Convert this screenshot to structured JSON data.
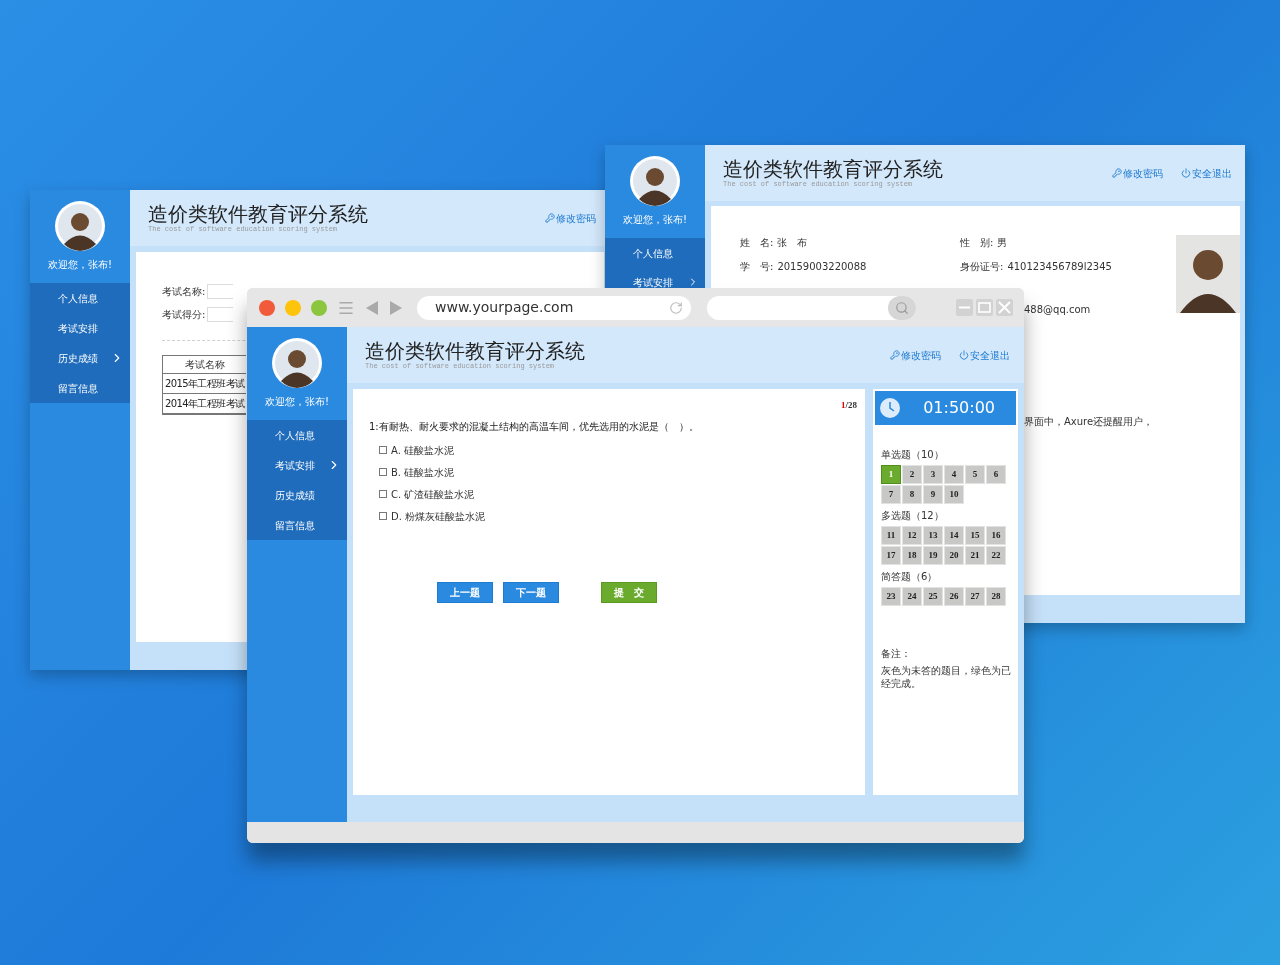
{
  "left_window": {
    "header": {
      "title": "造价类软件教育评分系统",
      "subtitle": "The cost of software education scoring system",
      "links": [
        {
          "kind": "key",
          "label": "修改密码"
        }
      ]
    },
    "sidebar": {
      "welcome": "欢迎您，张布!",
      "items": [
        {
          "label": "个人信息",
          "has_submenu": false
        },
        {
          "label": "考试安排",
          "has_submenu": false
        },
        {
          "label": "历史成绩",
          "has_submenu": true
        },
        {
          "label": "留言信息",
          "has_submenu": false
        }
      ]
    },
    "form": {
      "fields": [
        {
          "label": "考试名称:"
        },
        {
          "label": "考试得分:"
        }
      ]
    },
    "table": {
      "column": "考试名称",
      "rows": [
        "2015年工程班考试",
        "2014年工程班考试"
      ]
    }
  },
  "right_window": {
    "header": {
      "title": "造价类软件教育评分系统",
      "subtitle": "The cost of software education scoring system",
      "links": [
        {
          "kind": "key",
          "label": "修改密码"
        },
        {
          "kind": "power",
          "label": "安全退出"
        }
      ]
    },
    "sidebar": {
      "welcome": "欢迎您，张布!",
      "items": [
        {
          "label": "个人信息",
          "has_submenu": false
        },
        {
          "label": "考试安排",
          "has_submenu": true
        }
      ]
    },
    "profile": {
      "fields": [
        {
          "label": "姓　名:",
          "value": "张　布"
        },
        {
          "label": "性　别:",
          "value": "男"
        },
        {
          "label": "学　号:",
          "value": "20159003220088"
        },
        {
          "label": "身份证号:",
          "value": "410123456789l2345"
        }
      ]
    },
    "fragments": [
      "488@qq.com",
      "界面中，Axure还提醒用户，"
    ]
  },
  "browser": {
    "url": "www.yourpage.com"
  },
  "exam": {
    "header": {
      "title": "造价类软件教育评分系统",
      "subtitle": "The cost of software education scoring system",
      "links": [
        {
          "kind": "key",
          "label": "修改密码"
        },
        {
          "kind": "power",
          "label": "安全退出"
        }
      ]
    },
    "sidebar": {
      "welcome": "欢迎您，张布!",
      "items": [
        {
          "label": "个人信息",
          "has_submenu": false
        },
        {
          "label": "考试安排",
          "has_submenu": true
        },
        {
          "label": "历史成绩",
          "has_submenu": false
        },
        {
          "label": "留言信息",
          "has_submenu": false
        }
      ]
    },
    "question": {
      "current": "1",
      "total": "/28",
      "text": "1:有耐热、耐火要求的混凝土结构的高温车间，优先选用的水泥是（　）。",
      "options": [
        {
          "label": "A. 硅酸盐水泥",
          "checked": false
        },
        {
          "label": "B. 硅酸盐水泥",
          "checked": false
        },
        {
          "label": "C. 矿渣硅酸盐水泥",
          "checked": false
        },
        {
          "label": "D. 粉煤灰硅酸盐水泥",
          "checked": false
        }
      ]
    },
    "buttons": [
      {
        "label": "上一题",
        "kind": "nav"
      },
      {
        "label": "下一题",
        "kind": "nav"
      },
      {
        "label": "提　交",
        "kind": "submit"
      }
    ],
    "timer": "01:50:00",
    "sections": [
      {
        "title": "单选题（10）",
        "questions": [
          {
            "label": "1",
            "done": true
          },
          {
            "label": "2",
            "done": false
          },
          {
            "label": "3",
            "done": false
          },
          {
            "label": "4",
            "done": false
          },
          {
            "label": "5",
            "done": false
          },
          {
            "label": "6",
            "done": false
          },
          {
            "label": "7",
            "done": false
          },
          {
            "label": "8",
            "done": false
          },
          {
            "label": "9",
            "done": false
          },
          {
            "label": "10",
            "done": false
          }
        ]
      },
      {
        "title": "多选题（12）",
        "questions": [
          {
            "label": "11",
            "done": false
          },
          {
            "label": "12",
            "done": false
          },
          {
            "label": "13",
            "done": false
          },
          {
            "label": "14",
            "done": false
          },
          {
            "label": "15",
            "done": false
          },
          {
            "label": "16",
            "done": false
          },
          {
            "label": "17",
            "done": false
          },
          {
            "label": "18",
            "done": false
          },
          {
            "label": "19",
            "done": false
          },
          {
            "label": "20",
            "done": false
          },
          {
            "label": "21",
            "done": false
          },
          {
            "label": "22",
            "done": false
          }
        ]
      },
      {
        "title": "简答题（6）",
        "questions": [
          {
            "label": "23",
            "done": false
          },
          {
            "label": "24",
            "done": false
          },
          {
            "label": "25",
            "done": false
          },
          {
            "label": "26",
            "done": false
          },
          {
            "label": "27",
            "done": false
          },
          {
            "label": "28",
            "done": false
          }
        ]
      }
    ],
    "note": {
      "title": "备注：",
      "text": "灰色为未答的题目，绿色为已经完成。"
    }
  }
}
